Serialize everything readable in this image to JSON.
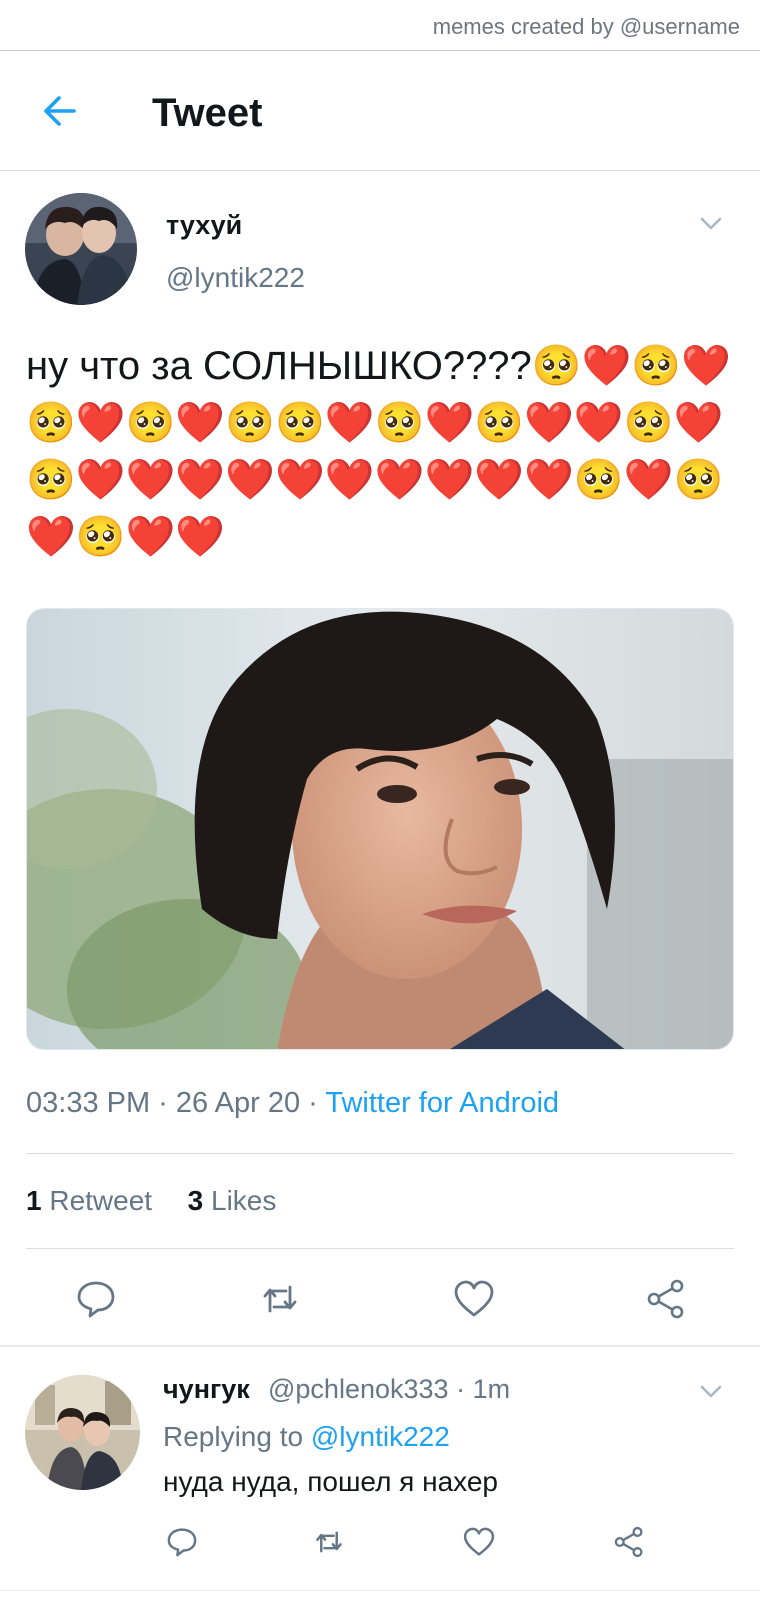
{
  "watermark": "memes created by @username",
  "header": {
    "title": "Tweet"
  },
  "tweet": {
    "author_name": "тухуй",
    "author_handle": "@lyntik222",
    "text": "ну что за СОЛНЫШКО????🥺❤️🥺❤️🥺❤️🥺❤️🥺🥺❤️🥺❤️🥺❤️❤️🥺❤️🥺❤️❤️❤️❤️❤️❤️❤️❤️❤️❤️🥺❤️🥺❤️🥺❤️❤️",
    "time": "03:33 PM",
    "date": "26 Apr 20",
    "source": "Twitter for Android",
    "retweets_count": "1",
    "retweets_label": "Retweet",
    "likes_count": "3",
    "likes_label": "Likes"
  },
  "reply": {
    "author_name": "чунгук",
    "author_handle": "@pchlenok333",
    "time": "1m",
    "replying_label": "Replying to",
    "replying_handle": "@lyntik222",
    "text": "нуда нуда, пошел я нахер"
  },
  "icons": {
    "back": "arrow-left-icon",
    "more": "chevron-down-icon",
    "reply": "speech-bubble-icon",
    "retweet": "retweet-icon",
    "like": "heart-outline-icon",
    "share": "share-icon"
  },
  "colors": {
    "accent": "#1da1f2",
    "muted": "#657786",
    "text": "#14171a"
  }
}
